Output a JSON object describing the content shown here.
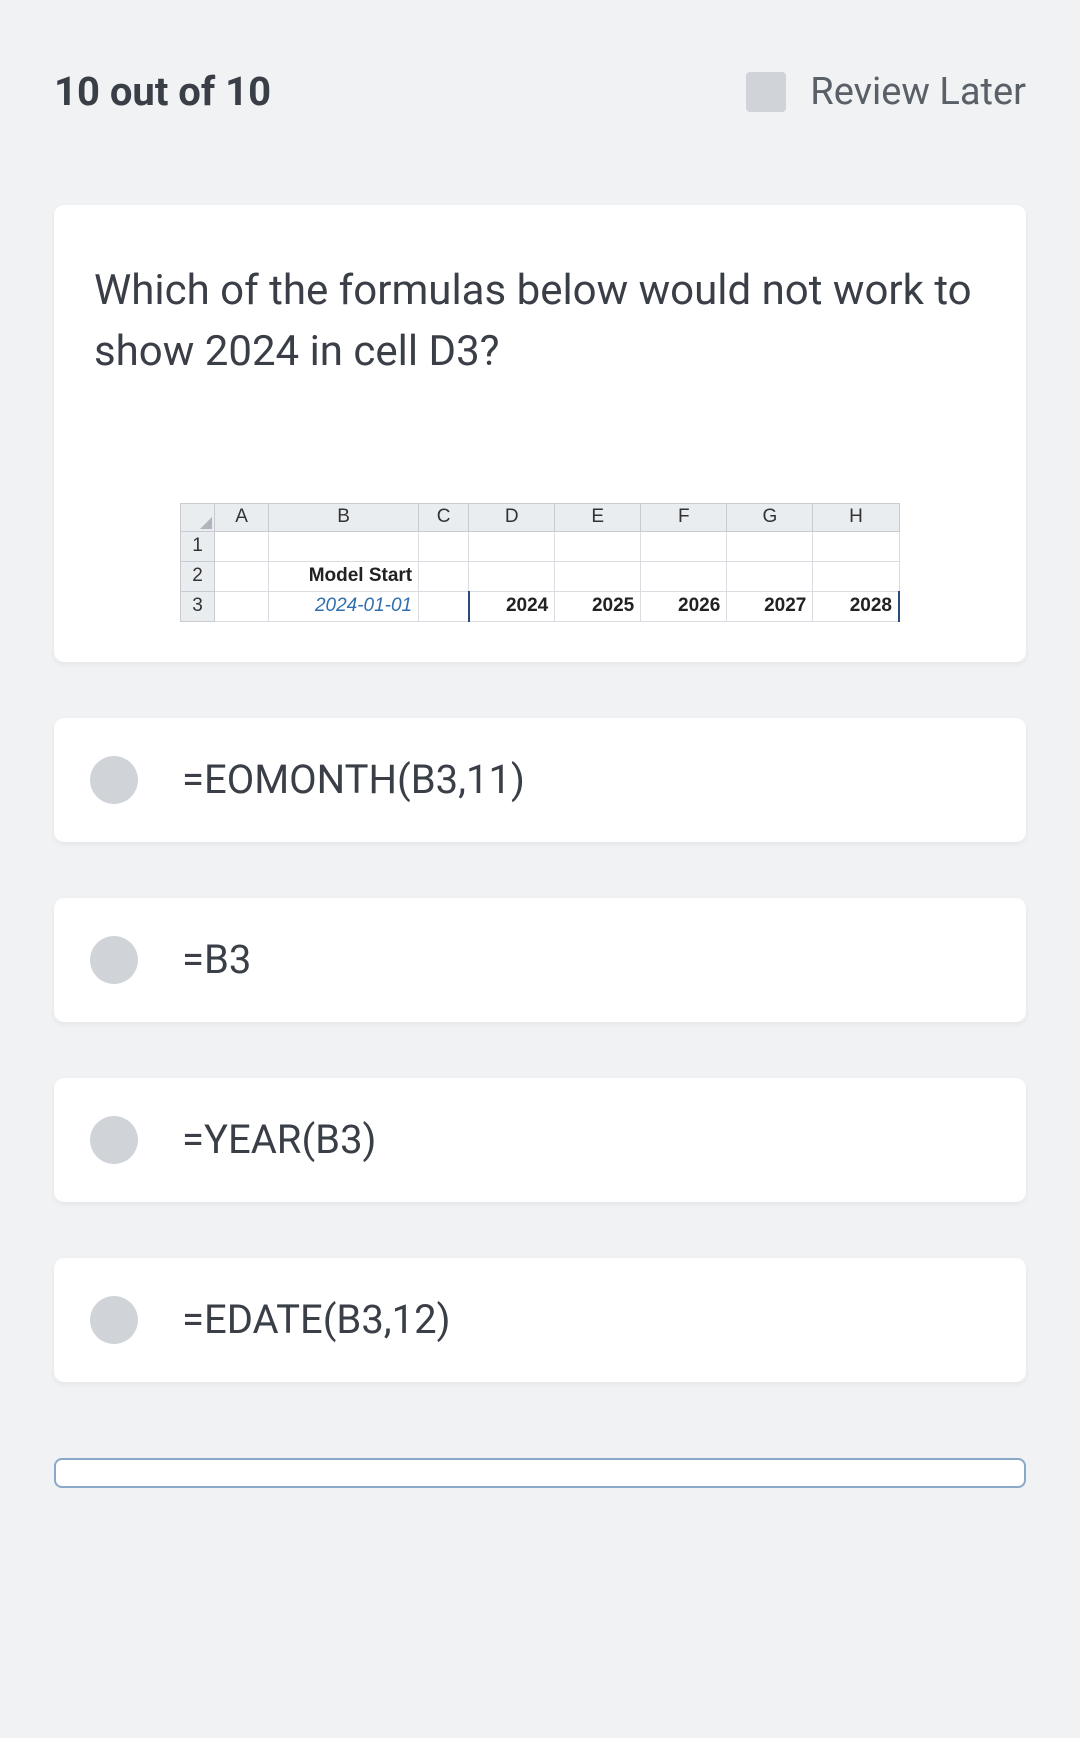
{
  "header": {
    "progress": "10 out of 10",
    "review_label": "Review Later"
  },
  "question": {
    "text": "Which of the formulas below would not work to show 2024 in cell D3?"
  },
  "spreadsheet": {
    "columns": [
      "A",
      "B",
      "C",
      "D",
      "E",
      "F",
      "G",
      "H"
    ],
    "rows": [
      "1",
      "2",
      "3"
    ],
    "b2_label": "Model Start",
    "b3_value": "2024-01-01",
    "years": [
      "2024",
      "2025",
      "2026",
      "2027",
      "2028"
    ]
  },
  "options": [
    {
      "label": "=EOMONTH(B3,11)"
    },
    {
      "label": "=B3"
    },
    {
      "label": "=YEAR(B3)"
    },
    {
      "label": "=EDATE(B3,12)"
    }
  ]
}
